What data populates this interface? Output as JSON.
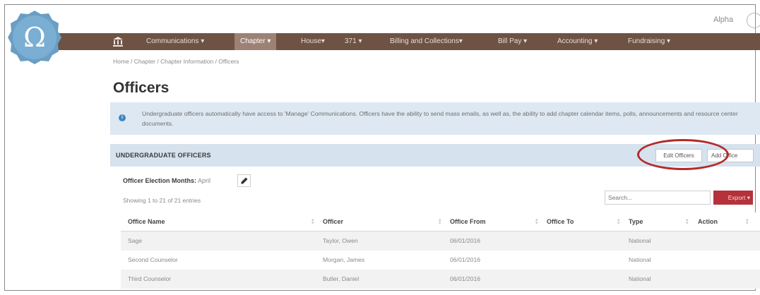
{
  "header": {
    "logo_symbol": "Ω",
    "user_label": "Alpha"
  },
  "nav": {
    "home_icon": "bank-icon",
    "items": [
      {
        "label": "Communications ▾"
      },
      {
        "label": "Chapter ▾"
      },
      {
        "label": "House▾"
      },
      {
        "label": "371 ▾"
      },
      {
        "label": "Billing and Collections▾"
      },
      {
        "label": "Bill Pay ▾"
      },
      {
        "label": "Accounting ▾"
      },
      {
        "label": "Fundraising ▾"
      }
    ]
  },
  "breadcrumb": "Home / Chapter / Chapter Information / Officers",
  "page_title": "Officers",
  "alert": {
    "text": "Undergraduate officers automatically have access to 'Manage' Communications. Officers have the ability to send mass emails, as well as, the ability to add chapter calendar items, polls, announcements and resource center documents."
  },
  "section": {
    "title": "UNDERGRADUATE OFFICERS",
    "edit_button": "Edit Officers",
    "add_button": "Add Office"
  },
  "election": {
    "label": "Officer Election Months:",
    "month": "April"
  },
  "table_info": "Showing 1 to 21 of 21 entries",
  "search": {
    "placeholder": "Search..."
  },
  "export_label": "Export ▾",
  "table": {
    "columns": [
      "Office Name",
      "Officer",
      "Office From",
      "Office To",
      "Type",
      "Action"
    ],
    "rows": [
      [
        "Sage",
        "Taylor, Owen",
        "06/01/2016",
        "",
        "National",
        ""
      ],
      [
        "Second Counselor",
        "Morgan, James",
        "06/01/2016",
        "",
        "National",
        ""
      ],
      [
        "Third Counselor",
        "Butler, Daniel",
        "06/01/2016",
        "",
        "National",
        ""
      ]
    ]
  },
  "colors": {
    "nav_bg": "#6e5244",
    "nav_active": "#9c8174",
    "logo_bg": "#6a9ec4",
    "alert_bg": "#dde8f2",
    "section_bg": "#d6e2ee",
    "export_bg": "#b5323b",
    "highlight_ring": "#b52a2a"
  }
}
